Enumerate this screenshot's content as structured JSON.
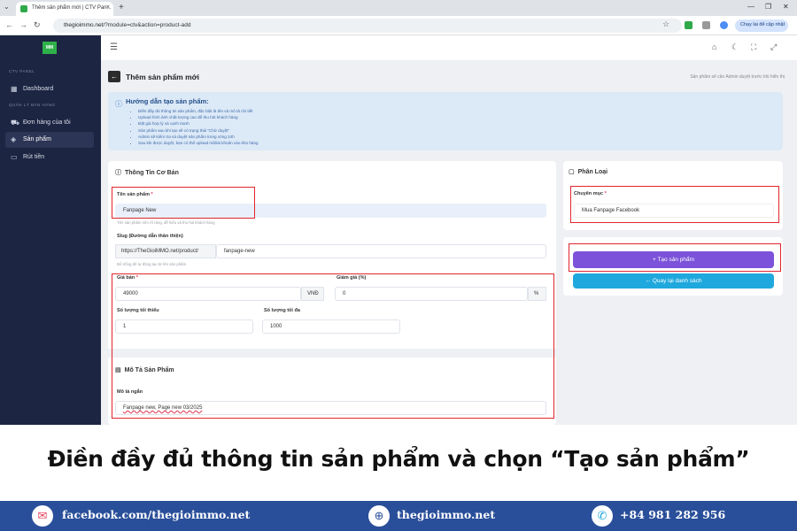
{
  "browser": {
    "tab_title": "Thêm sản phẩm mới | CTV Pan...",
    "url_domain": "thegioimmo.net",
    "url_path": "/?module=ctv&action=product-add",
    "gemini_label": "Chạy lại để cập nhật"
  },
  "sidebar": {
    "logo_text": "MM",
    "group_panel": "CTV PANEL",
    "group_sales": "QUẢN LÝ BÁN HÀNG",
    "items": [
      {
        "label": "Dashboard",
        "icon": "grid-icon"
      },
      {
        "label": "Đơn hàng của tôi",
        "icon": "cart-icon"
      },
      {
        "label": "Sản phẩm",
        "icon": "box-icon"
      },
      {
        "label": "Rút tiền",
        "icon": "wallet-icon"
      }
    ]
  },
  "page": {
    "title": "Thêm sản phẩm mới",
    "note": "Sản phẩm sẽ cần Admin duyệt trước khi hiển thị",
    "back_glyph": "←"
  },
  "guide": {
    "title": "Hướng dẫn tạo sản phẩm:",
    "items": [
      "Điền đầy đủ thông tin sản phẩm, đặc biệt là tên và mô tả chi tiết",
      "Upload hình ảnh chất lượng cao để thu hút khách hàng",
      "Đặt giá hợp lý và cạnh tranh",
      "Sản phẩm sau khi tạo sẽ có trạng thái \"Chờ duyệt\"",
      "Admin sẽ kiểm tra và duyệt sản phẩm trong vòng 24h",
      "Sau khi được duyệt, bạn có thể upload mã/tài khoản vào kho hàng"
    ]
  },
  "basic_info": {
    "title": "Thông Tin Cơ Bản",
    "name_label": "Tên sản phẩm",
    "name_value": "Fanpage New",
    "name_hint": "Tên sản phẩm nên rõ ràng, dễ hiểu và thu hút khách hàng",
    "slug_label": "Slug (Đường dẫn thân thiện)",
    "slug_prefix": "https://TheGioiMMO.net/product/",
    "slug_value": "fanpage-new",
    "slug_hint": "Để trống để tự động tạo từ tên sản phẩm",
    "price_label": "Giá bán",
    "price_value": "49000",
    "price_unit": "VNĐ",
    "discount_label": "Giảm giá (%)",
    "discount_value": "0",
    "discount_unit": "%",
    "min_label": "Số lượng tối thiểu",
    "min_value": "1",
    "max_label": "Số lượng tối đa",
    "max_value": "1000"
  },
  "description": {
    "title": "Mô Tả Sản Phẩm",
    "short_label": "Mô tả ngắn",
    "short_value": "Fanpage new, Page new 03/2025"
  },
  "category": {
    "title": "Phân Loại",
    "label": "Chuyên mục",
    "value": "Mua Fanpage Facebook"
  },
  "actions": {
    "create_label": "+ Tạo sản phẩm",
    "back_label": "← Quay lại danh sách",
    "create_color": "#7b52d9",
    "back_color": "#1fa8dd"
  },
  "banner": {
    "caption": "Điền đầy đủ thông tin sản phẩm và chọn “Tạo sản phẩm”"
  },
  "footer": {
    "facebook": "facebook.com/thegioimmo.net",
    "website": "thegioimmo.net",
    "phone": "+84 981 282 956"
  }
}
